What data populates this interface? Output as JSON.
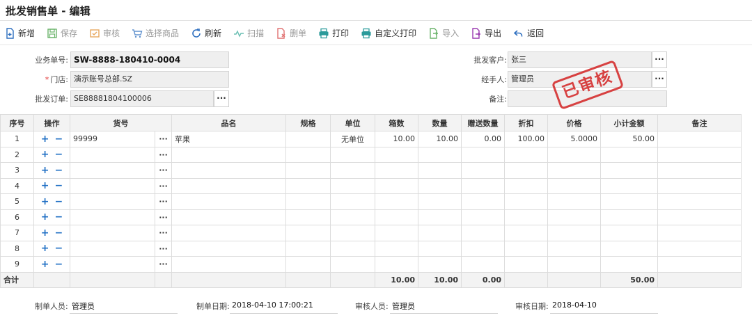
{
  "page_title": "批发销售单 - 编辑",
  "toolbar": [
    {
      "label": "新增",
      "icon": "new-doc-icon",
      "color": "#2e6fbf",
      "disabled": false
    },
    {
      "label": "保存",
      "icon": "save-icon",
      "color": "#3a9b3a",
      "disabled": true
    },
    {
      "label": "审核",
      "icon": "approve-icon",
      "color": "#e08a2a",
      "disabled": true
    },
    {
      "label": "选择商品",
      "icon": "select-goods-icon",
      "color": "#2e6fbf",
      "disabled": true
    },
    {
      "label": "刷新",
      "icon": "refresh-icon",
      "color": "#2e6fbf",
      "disabled": false
    },
    {
      "label": "扫描",
      "icon": "scan-icon",
      "color": "#3aaa9a",
      "disabled": true
    },
    {
      "label": "删单",
      "icon": "delete-doc-icon",
      "color": "#d84343",
      "disabled": true
    },
    {
      "label": "打印",
      "icon": "print-icon",
      "color": "#2a9a9a",
      "disabled": false
    },
    {
      "label": "自定义打印",
      "icon": "custom-print-icon",
      "color": "#2a9a9a",
      "disabled": false
    },
    {
      "label": "导入",
      "icon": "import-icon",
      "color": "#3a9b3a",
      "disabled": true
    },
    {
      "label": "导出",
      "icon": "export-icon",
      "color": "#9a3ab0",
      "disabled": false
    },
    {
      "label": "返回",
      "icon": "back-arrow-icon",
      "color": "#2e6fbf",
      "disabled": false
    }
  ],
  "form": {
    "order_no_label": "业务单号:",
    "order_no": "SW-8888-180410-0004",
    "store_label": "门店:",
    "store_required_mark": "*",
    "store": "演示账号总部.SZ",
    "wholesale_order_label": "批发订单:",
    "wholesale_order": "SE88881804100006",
    "customer_label": "批发客户:",
    "customer": "张三",
    "handler_label": "经手人:",
    "handler": "管理员",
    "remark_label": "备注:",
    "remark": ""
  },
  "dots_label": "···",
  "stamp_text": "已审核",
  "grid": {
    "headers": [
      "序号",
      "操作",
      "货号",
      "",
      "品名",
      "规格",
      "单位",
      "箱数",
      "数量",
      "赠送数量",
      "折扣",
      "价格",
      "小计金额",
      "备注"
    ],
    "rows": [
      {
        "idx": "1",
        "sku": "99999",
        "name": "苹果",
        "spec": "",
        "unit": "无单位",
        "boxes": "10.00",
        "qty": "10.00",
        "gift": "0.00",
        "discount": "100.00",
        "price": "5.0000",
        "subtotal": "50.00",
        "remark": ""
      },
      {
        "idx": "2",
        "sku": "",
        "name": "",
        "spec": "",
        "unit": "",
        "boxes": "",
        "qty": "",
        "gift": "",
        "discount": "",
        "price": "",
        "subtotal": "",
        "remark": ""
      },
      {
        "idx": "3",
        "sku": "",
        "name": "",
        "spec": "",
        "unit": "",
        "boxes": "",
        "qty": "",
        "gift": "",
        "discount": "",
        "price": "",
        "subtotal": "",
        "remark": ""
      },
      {
        "idx": "4",
        "sku": "",
        "name": "",
        "spec": "",
        "unit": "",
        "boxes": "",
        "qty": "",
        "gift": "",
        "discount": "",
        "price": "",
        "subtotal": "",
        "remark": ""
      },
      {
        "idx": "5",
        "sku": "",
        "name": "",
        "spec": "",
        "unit": "",
        "boxes": "",
        "qty": "",
        "gift": "",
        "discount": "",
        "price": "",
        "subtotal": "",
        "remark": ""
      },
      {
        "idx": "6",
        "sku": "",
        "name": "",
        "spec": "",
        "unit": "",
        "boxes": "",
        "qty": "",
        "gift": "",
        "discount": "",
        "price": "",
        "subtotal": "",
        "remark": ""
      },
      {
        "idx": "7",
        "sku": "",
        "name": "",
        "spec": "",
        "unit": "",
        "boxes": "",
        "qty": "",
        "gift": "",
        "discount": "",
        "price": "",
        "subtotal": "",
        "remark": ""
      },
      {
        "idx": "8",
        "sku": "",
        "name": "",
        "spec": "",
        "unit": "",
        "boxes": "",
        "qty": "",
        "gift": "",
        "discount": "",
        "price": "",
        "subtotal": "",
        "remark": ""
      },
      {
        "idx": "9",
        "sku": "",
        "name": "",
        "spec": "",
        "unit": "",
        "boxes": "",
        "qty": "",
        "gift": "",
        "discount": "",
        "price": "",
        "subtotal": "",
        "remark": ""
      }
    ],
    "total": {
      "label": "合计",
      "boxes": "10.00",
      "qty": "10.00",
      "gift": "0.00",
      "subtotal": "50.00"
    },
    "add_symbol": "+",
    "remove_symbol": "−"
  },
  "footer": {
    "maker_label": "制单人员:",
    "maker": "管理员",
    "make_date_label": "制单日期:",
    "make_date": "2018-04-10 17:00:21",
    "auditor_label": "审核人员:",
    "auditor": "管理员",
    "audit_date_label": "审核日期:",
    "audit_date": "2018-04-10"
  }
}
